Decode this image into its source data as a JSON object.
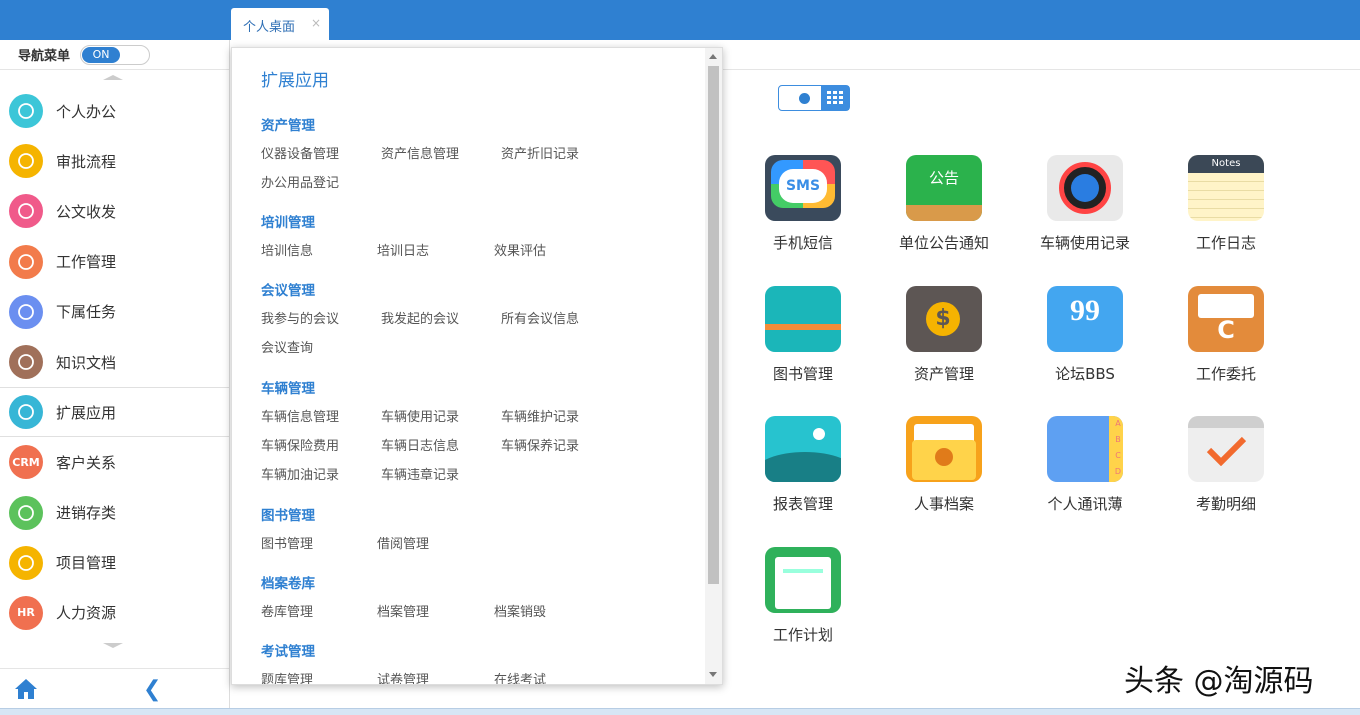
{
  "tab": {
    "label": "个人桌面",
    "close": "×"
  },
  "nav": {
    "label": "导航菜单",
    "toggle": "ON"
  },
  "menu": [
    {
      "label": "个人办公",
      "color": "#3cc6d8",
      "icon": "person-icon"
    },
    {
      "label": "审批流程",
      "color": "#f5b400",
      "icon": "edit-icon"
    },
    {
      "label": "公文收发",
      "color": "#f05a8a",
      "icon": "document-icon"
    },
    {
      "label": "工作管理",
      "color": "#f27b4b",
      "icon": "papers-icon"
    },
    {
      "label": "下属任务",
      "color": "#6b8ff0",
      "icon": "team-icon"
    },
    {
      "label": "知识文档",
      "color": "#a0705a",
      "icon": "book-icon"
    },
    {
      "label": "扩展应用",
      "color": "#37b6d6",
      "icon": "apps-icon"
    },
    {
      "label": "客户关系",
      "color": "#f07050",
      "icon": "crm-icon",
      "text": "CRM"
    },
    {
      "label": "进销存类",
      "color": "#5cc25c",
      "icon": "box-icon"
    },
    {
      "label": "项目管理",
      "color": "#f5b400",
      "icon": "clipboard-icon"
    },
    {
      "label": "人力资源",
      "color": "#f07050",
      "icon": "hr-icon",
      "text": "HR"
    }
  ],
  "popup": {
    "title": "扩展应用",
    "categories": [
      {
        "name": "资产管理",
        "links": [
          "仪器设备管理",
          "资产信息管理",
          "资产折旧记录",
          "办公用品登记"
        ]
      },
      {
        "name": "培训管理",
        "links": [
          "培训信息",
          "培训日志",
          "效果评估"
        ]
      },
      {
        "name": "会议管理",
        "links": [
          "我参与的会议",
          "我发起的会议",
          "所有会议信息",
          "会议查询"
        ]
      },
      {
        "name": "车辆管理",
        "links": [
          "车辆信息管理",
          "车辆使用记录",
          "车辆维护记录",
          "车辆保险费用",
          "车辆日志信息",
          "车辆保养记录",
          "车辆加油记录",
          "车辆违章记录"
        ]
      },
      {
        "name": "图书管理",
        "links": [
          "图书管理",
          "借阅管理"
        ]
      },
      {
        "name": "档案卷库",
        "links": [
          "卷库管理",
          "档案管理",
          "档案销毁"
        ]
      },
      {
        "name": "考试管理",
        "links": [
          "题库管理",
          "试卷管理",
          "在线考试"
        ]
      }
    ]
  },
  "apps": [
    {
      "label": "手机短信",
      "icon": "sms-icon",
      "text": "SMS"
    },
    {
      "label": "单位公告通知",
      "icon": "notice-icon",
      "text": "公告"
    },
    {
      "label": "车辆使用记录",
      "icon": "gauge-icon"
    },
    {
      "label": "工作日志",
      "icon": "notes-icon",
      "text": "Notes"
    },
    {
      "label": "图书管理",
      "icon": "book-icon"
    },
    {
      "label": "资产管理",
      "icon": "wallet-icon",
      "text": "$"
    },
    {
      "label": "论坛BBS",
      "icon": "quote-icon",
      "text": "99"
    },
    {
      "label": "工作委托",
      "icon": "tray-icon",
      "text": "C"
    },
    {
      "label": "报表管理",
      "icon": "chart-icon"
    },
    {
      "label": "人事档案",
      "icon": "folder-person-icon"
    },
    {
      "label": "个人通讯薄",
      "icon": "contacts-icon",
      "text": "A B C D"
    },
    {
      "label": "考勤明细",
      "icon": "calendar-check-icon"
    },
    {
      "label": "工作计划",
      "icon": "checklist-icon"
    }
  ],
  "watermark": "头条 @淘源码"
}
